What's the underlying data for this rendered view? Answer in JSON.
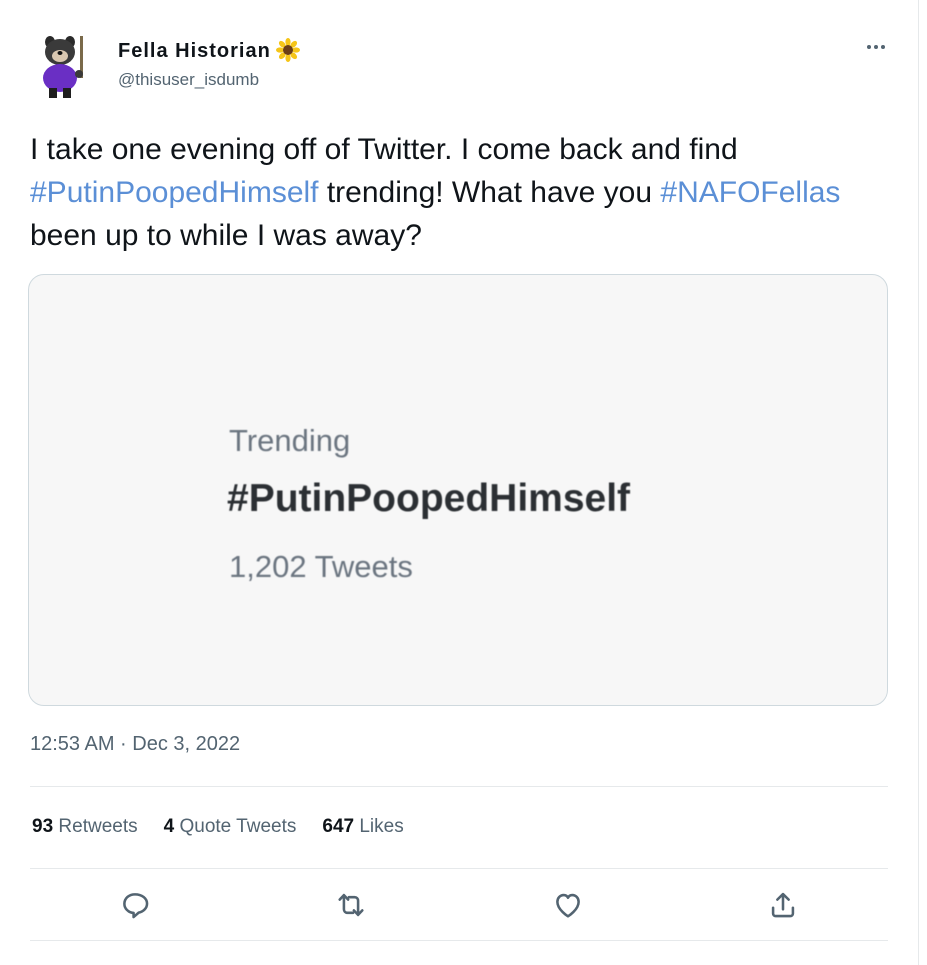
{
  "author": {
    "name": "Fella Historian",
    "handle": "@thisuser_isdumb",
    "flag_icon": "sunflower-emoji"
  },
  "tweet": {
    "text_part1": "I take one evening off of Twitter. I come back and find ",
    "hashtag1": "#PutinPoopedHimself",
    "text_part2": " trending! What have you ",
    "hashtag2": "#NAFOFellas",
    "text_part3": " been up to while I was away?"
  },
  "media": {
    "trend_label": "Trending",
    "trend_name": "#PutinPoopedHimself",
    "trend_count": "1,202 Tweets"
  },
  "timestamp": "12:53 AM · Dec 3, 2022",
  "stats": {
    "retweets_count": "93",
    "retweets_label": "Retweets",
    "quotes_count": "4",
    "quotes_label": "Quote Tweets",
    "likes_count": "647",
    "likes_label": "Likes"
  },
  "actions": [
    "reply-icon",
    "retweet-icon",
    "like-icon",
    "share-icon"
  ],
  "colors": {
    "hashtag": "#5b8fd6",
    "secondary_text": "#536471",
    "primary_text": "#0f1419",
    "avatar_purple": "#6a2fc4"
  }
}
